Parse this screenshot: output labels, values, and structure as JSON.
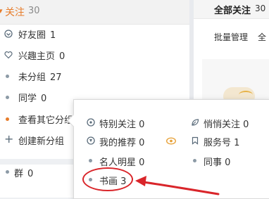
{
  "sidebar": {
    "header": {
      "title": "关注",
      "count": "30"
    },
    "items": [
      {
        "label": "好友圈",
        "count": "1",
        "icon": "friend-circle-icon"
      },
      {
        "label": "兴趣主页",
        "count": "0",
        "icon": "heart-icon"
      },
      {
        "label": "未分组",
        "count": "27",
        "icon": "dot"
      },
      {
        "label": "同学",
        "count": "0",
        "icon": "dot"
      },
      {
        "label": "查看其它分组",
        "count": "",
        "icon": "dot"
      },
      {
        "label": "创建新分组",
        "count": "",
        "icon": "plus-icon"
      }
    ],
    "group": {
      "label": "群",
      "count": "0"
    }
  },
  "right": {
    "title": "全部关注",
    "count": "30",
    "manage": "批量管理",
    "manage_extra": "全"
  },
  "popup": {
    "left_items": [
      {
        "label": "特别关注",
        "count": "0",
        "icon": "special-follow-icon"
      },
      {
        "label": "我的推荐",
        "count": "0",
        "icon": "recommend-icon"
      },
      {
        "label": "名人明星",
        "count": "0",
        "icon": "dot"
      },
      {
        "label": "书画",
        "count": "3",
        "icon": "dot"
      }
    ],
    "right_items": [
      {
        "label": "悄悄关注",
        "count": "0",
        "icon": "leaf-icon"
      },
      {
        "label": "服务号",
        "count": "1",
        "icon": "bookmark-icon"
      },
      {
        "label": "同事",
        "count": "0",
        "icon": "dot"
      }
    ]
  },
  "colors": {
    "accent": "#e77c2a",
    "annotation": "#d9252a"
  }
}
